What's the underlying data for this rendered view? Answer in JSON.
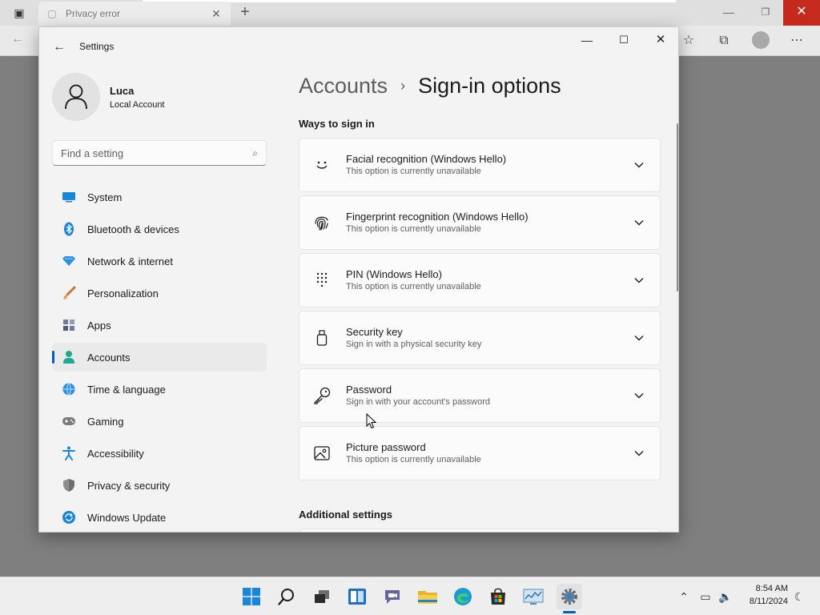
{
  "browser": {
    "tab_title": "Privacy error",
    "new_tab_symbol": "+",
    "close_symbol": "✕"
  },
  "settings": {
    "window_title": "Settings",
    "profile": {
      "name": "Luca",
      "account_type": "Local Account"
    },
    "search": {
      "placeholder": "Find a setting"
    },
    "nav": [
      {
        "label": "System",
        "icon": "monitor-icon",
        "active": false
      },
      {
        "label": "Bluetooth & devices",
        "icon": "bluetooth-icon",
        "active": false
      },
      {
        "label": "Network & internet",
        "icon": "wifi-diamond-icon",
        "active": false
      },
      {
        "label": "Personalization",
        "icon": "brush-icon",
        "active": false
      },
      {
        "label": "Apps",
        "icon": "apps-icon",
        "active": false
      },
      {
        "label": "Accounts",
        "icon": "person-icon",
        "active": true
      },
      {
        "label": "Time & language",
        "icon": "globe-clock-icon",
        "active": false
      },
      {
        "label": "Gaming",
        "icon": "gamepad-icon",
        "active": false
      },
      {
        "label": "Accessibility",
        "icon": "accessibility-icon",
        "active": false
      },
      {
        "label": "Privacy & security",
        "icon": "shield-icon",
        "active": false
      },
      {
        "label": "Windows Update",
        "icon": "update-icon",
        "active": false
      }
    ],
    "breadcrumb": {
      "parent": "Accounts",
      "separator": "›",
      "current": "Sign-in options"
    },
    "ways_to_sign_in": {
      "title": "Ways to sign in",
      "options": [
        {
          "title": "Facial recognition (Windows Hello)",
          "subtitle": "This option is currently unavailable",
          "icon": "face-icon"
        },
        {
          "title": "Fingerprint recognition (Windows Hello)",
          "subtitle": "This option is currently unavailable",
          "icon": "fingerprint-icon"
        },
        {
          "title": "PIN (Windows Hello)",
          "subtitle": "This option is currently unavailable",
          "icon": "pin-keypad-icon"
        },
        {
          "title": "Security key",
          "subtitle": "Sign in with a physical security key",
          "icon": "usb-key-icon"
        },
        {
          "title": "Password",
          "subtitle": "Sign in with your account's password",
          "icon": "key-icon"
        },
        {
          "title": "Picture password",
          "subtitle": "This option is currently unavailable",
          "icon": "picture-icon"
        }
      ]
    },
    "additional_settings": {
      "title": "Additional settings"
    }
  },
  "taskbar": {
    "time": "8:54 AM",
    "date": "8/11/2024"
  },
  "colors": {
    "accent": "#005fb8",
    "close_red": "#c42b1c",
    "window_bg": "#f3f3f3",
    "card_bg": "#fbfbfb",
    "backdrop": "#7f7f7f"
  }
}
